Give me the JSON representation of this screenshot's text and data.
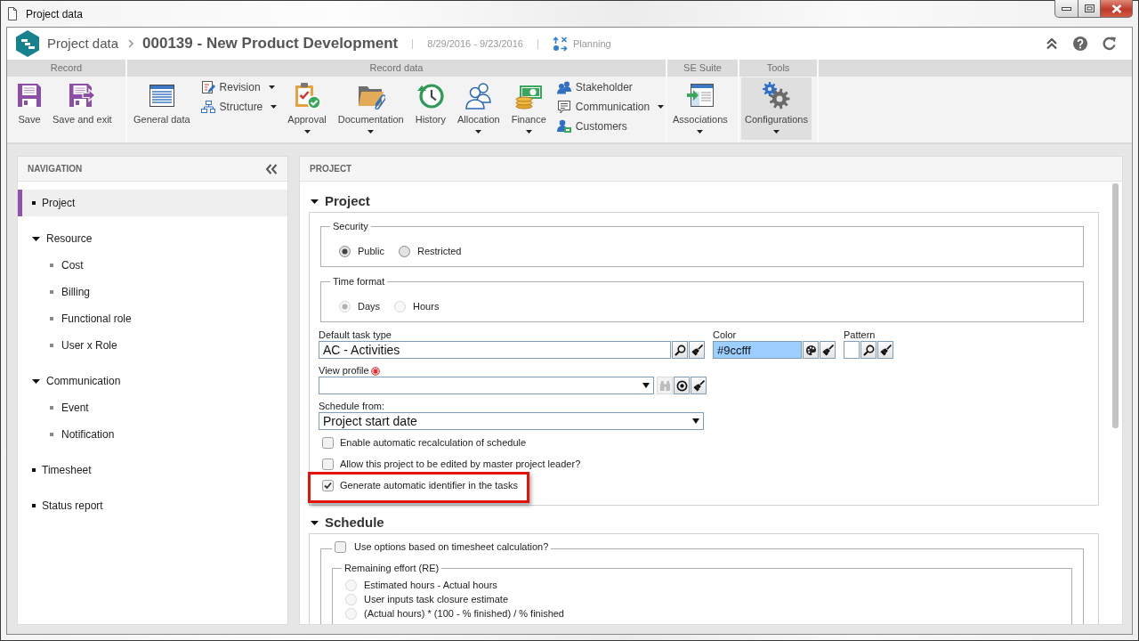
{
  "window": {
    "title": "Project data"
  },
  "header": {
    "breadcrumb": "Project data",
    "record_title": "000139 - New Product Development",
    "period": "8/29/2016 - 9/23/2016",
    "phase": "Planning"
  },
  "ribbon": {
    "groups": [
      {
        "label": "Record",
        "items": [
          {
            "kind": "large",
            "label": "Save",
            "dropdown": false,
            "highlighted": false
          },
          {
            "kind": "large",
            "label": "Save and exit",
            "dropdown": false,
            "highlighted": false
          }
        ]
      },
      {
        "label": "Record data",
        "items": [
          {
            "kind": "large",
            "label": "General data",
            "dropdown": false,
            "highlighted": false
          },
          {
            "kind": "stack",
            "items": [
              {
                "label": "Revision",
                "dropdown": true
              },
              {
                "label": "Structure",
                "dropdown": true
              }
            ]
          },
          {
            "kind": "large",
            "label": "Approval",
            "dropdown": true,
            "highlighted": false
          },
          {
            "kind": "large",
            "label": "Documentation",
            "dropdown": true,
            "highlighted": false
          },
          {
            "kind": "large",
            "label": "History",
            "dropdown": false,
            "highlighted": false
          },
          {
            "kind": "large",
            "label": "Allocation",
            "dropdown": true,
            "highlighted": false
          },
          {
            "kind": "large",
            "label": "Finance",
            "dropdown": true,
            "highlighted": false
          },
          {
            "kind": "stack",
            "items": [
              {
                "label": "Stakeholder",
                "dropdown": false
              },
              {
                "label": "Communication",
                "dropdown": true
              },
              {
                "label": "Customers",
                "dropdown": false
              }
            ]
          }
        ]
      },
      {
        "label": "SE Suite",
        "items": [
          {
            "kind": "large",
            "label": "Associations",
            "dropdown": true,
            "highlighted": false
          }
        ]
      },
      {
        "label": "Tools",
        "items": [
          {
            "kind": "large",
            "label": "Configurations",
            "dropdown": true,
            "highlighted": true
          }
        ]
      }
    ]
  },
  "navigation": {
    "title": "NAVIGATION",
    "items": [
      {
        "label": "Project",
        "selected": true
      },
      {
        "label": "Resource",
        "selected": false,
        "expanded": true,
        "children": [
          {
            "label": "Cost",
            "selected": false
          },
          {
            "label": "Billing",
            "selected": false
          },
          {
            "label": "Functional role",
            "selected": false
          },
          {
            "label": "User x Role",
            "selected": false
          }
        ]
      },
      {
        "label": "Communication",
        "selected": false,
        "expanded": true,
        "children": [
          {
            "label": "Event",
            "selected": false
          },
          {
            "label": "Notification",
            "selected": false
          }
        ]
      },
      {
        "label": "Timesheet",
        "selected": false
      },
      {
        "label": "Status report",
        "selected": false
      }
    ]
  },
  "panel": {
    "title": "PROJECT",
    "sections": [
      {
        "title": "Project",
        "expanded": true,
        "blocks": [
          {
            "kind": "radio_row",
            "legend": "Security",
            "disabled": false,
            "options": [
              {
                "label": "Public",
                "selected": true
              },
              {
                "label": "Restricted",
                "selected": false
              }
            ]
          },
          {
            "kind": "radio_row",
            "legend": "Time format",
            "disabled": true,
            "options": [
              {
                "label": "Days",
                "selected": true
              },
              {
                "label": "Hours",
                "selected": false
              }
            ]
          },
          {
            "kind": "field_row",
            "fields": [
              {
                "kind": "lookup",
                "label": "Default task type",
                "value": "AC - Activities"
              },
              {
                "kind": "color",
                "label": "Color",
                "value": "#9ccfff"
              },
              {
                "kind": "pattern",
                "label": "Pattern"
              }
            ]
          },
          {
            "kind": "field_row",
            "fields": [
              {
                "kind": "profile",
                "label": "View profile",
                "required": true
              }
            ]
          },
          {
            "kind": "field_row",
            "fields": [
              {
                "kind": "select",
                "label": "Schedule from:",
                "value": "Project start date"
              }
            ]
          },
          {
            "kind": "checkbox",
            "label": "Enable automatic recalculation of schedule",
            "checked": false,
            "annotated": false
          },
          {
            "kind": "checkbox",
            "label": "Allow this project to be edited by master project leader?",
            "checked": false,
            "annotated": false
          },
          {
            "kind": "checkbox",
            "label": "Generate automatic identifier in the tasks",
            "checked": true,
            "annotated": true
          }
        ]
      },
      {
        "title": "Schedule",
        "expanded": true,
        "blocks": [
          {
            "kind": "check_group",
            "label": "Use options based on timesheet calculation?",
            "checked": false,
            "groups": [
              {
                "kind": "radio_list",
                "legend": "Remaining effort (RE)",
                "disabled": true,
                "options": [
                  {
                    "label": "Estimated hours - Actual hours",
                    "selected": false
                  },
                  {
                    "label": "User inputs task closure estimate",
                    "selected": false
                  },
                  {
                    "label": "(Actual hours) * (100 - % finished) / % finished",
                    "selected": false
                  }
                ]
              }
            ]
          }
        ]
      }
    ]
  }
}
